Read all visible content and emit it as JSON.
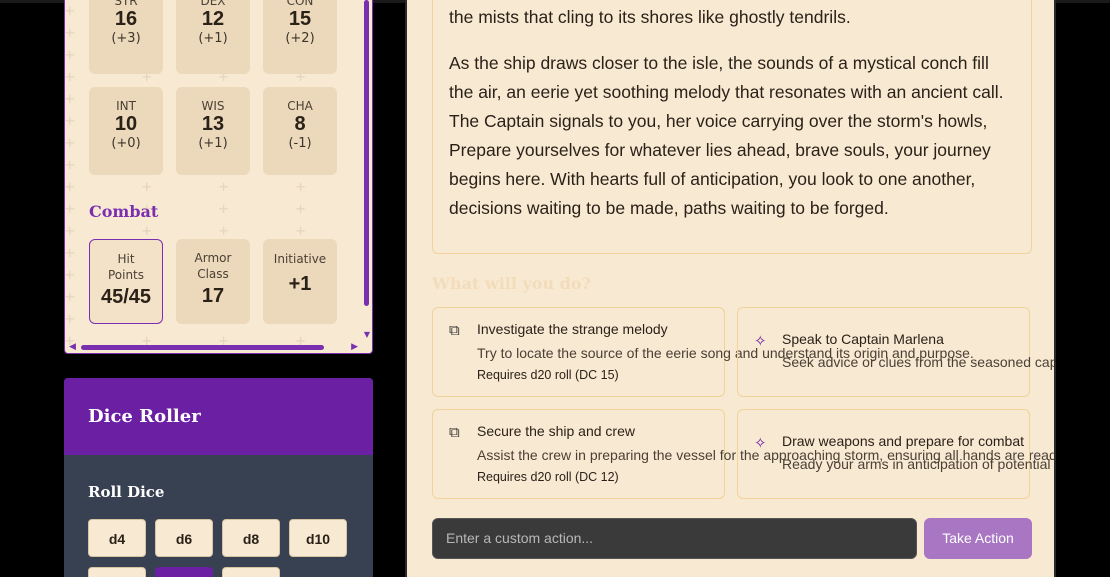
{
  "abilities": [
    {
      "label": "STR",
      "value": "16",
      "mod": "(+3)"
    },
    {
      "label": "DEX",
      "value": "12",
      "mod": "(+1)"
    },
    {
      "label": "CON",
      "value": "15",
      "mod": "(+2)"
    },
    {
      "label": "INT",
      "value": "10",
      "mod": "(+0)"
    },
    {
      "label": "WIS",
      "value": "13",
      "mod": "(+1)"
    },
    {
      "label": "CHA",
      "value": "8",
      "mod": "(-1)"
    }
  ],
  "combat": {
    "title": "Combat",
    "hp_label": "Hit Points",
    "hp_value": "45/45",
    "ac_label": "Armor Class",
    "ac_value": "17",
    "init_label": "Initiative",
    "init_value": "+1"
  },
  "dice": {
    "title": "Dice Roller",
    "subtitle": "Roll Dice",
    "buttons": [
      "d4",
      "d6",
      "d8",
      "d10"
    ]
  },
  "story": {
    "p1": "the mists that cling to its shores like ghostly tendrils.",
    "p2": "As the ship draws closer to the isle, the sounds of a mystical conch fill the air, an eerie yet soothing melody that resonates with an ancient call. The Captain signals to you, her voice carrying over the storm's howls,   Prepare yourselves for whatever lies ahead, brave souls, your journey begins here.   With hearts full of anticipation, you look to one another, decisions waiting to be made, paths waiting to be forged.",
    "prompt": "What will you do?"
  },
  "options": [
    {
      "title": "Investigate the strange melody",
      "desc": "Try to locate the source of the eerie song and understand its origin and purpose.",
      "req": "Requires d20 roll (DC 15)",
      "icon": "dice-icon"
    },
    {
      "title": "Speak to Captain Marlena",
      "desc": "Seek advice or clues from the seasoned captain abo",
      "icon": "sparkle-icon"
    },
    {
      "title": "Secure the ship and crew",
      "desc": "Assist the crew in preparing the vessel for the approaching storm, ensuring all hands are ready.",
      "req": "Requires d20 roll (DC 12)",
      "icon": "dice-icon"
    },
    {
      "title": "Draw weapons and prepare for combat",
      "desc": "Ready your arms in anticipation of potential threats",
      "icon": "sparkle-icon"
    }
  ],
  "action": {
    "placeholder": "Enter a custom action...",
    "button": "Take Action"
  },
  "colors": {
    "accent": "#6b1fa3",
    "parchment": "#f8e9d2",
    "slate": "#374151"
  }
}
